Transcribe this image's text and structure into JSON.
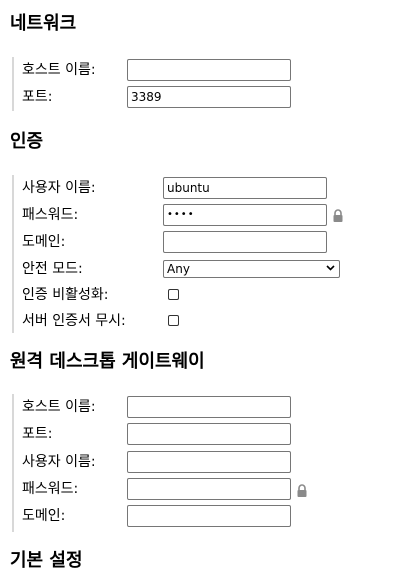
{
  "network": {
    "title": "네트워크",
    "hostname_label": "호스트 이름:",
    "hostname_value": "",
    "port_label": "포트:",
    "port_value": "3389"
  },
  "auth": {
    "title": "인증",
    "username_label": "사용자 이름:",
    "username_value": "ubuntu",
    "password_label": "패스워드:",
    "password_masked": "••••",
    "domain_label": "도메인:",
    "domain_value": "",
    "security_mode_label": "안전 모드:",
    "security_mode_value": "Any",
    "disable_auth_label": "인증 비활성화:",
    "disable_auth_checked": false,
    "ignore_cert_label": "서버 인증서 무시:",
    "ignore_cert_checked": false
  },
  "gateway": {
    "title": "원격 데스크톱 게이트웨이",
    "hostname_label": "호스트 이름:",
    "hostname_value": "",
    "port_label": "포트:",
    "port_value": "",
    "username_label": "사용자 이름:",
    "username_value": "",
    "password_label": "패스워드:",
    "password_value": "",
    "domain_label": "도메인:",
    "domain_value": ""
  },
  "basic": {
    "title": "기본 설정"
  },
  "icons": {
    "lock": "lock-icon",
    "select_arrow": "chevron-down-icon"
  },
  "colors": {
    "group_border": "#d8d8d8",
    "input_border": "#767676",
    "lock_icon": "#8a8a8a"
  }
}
